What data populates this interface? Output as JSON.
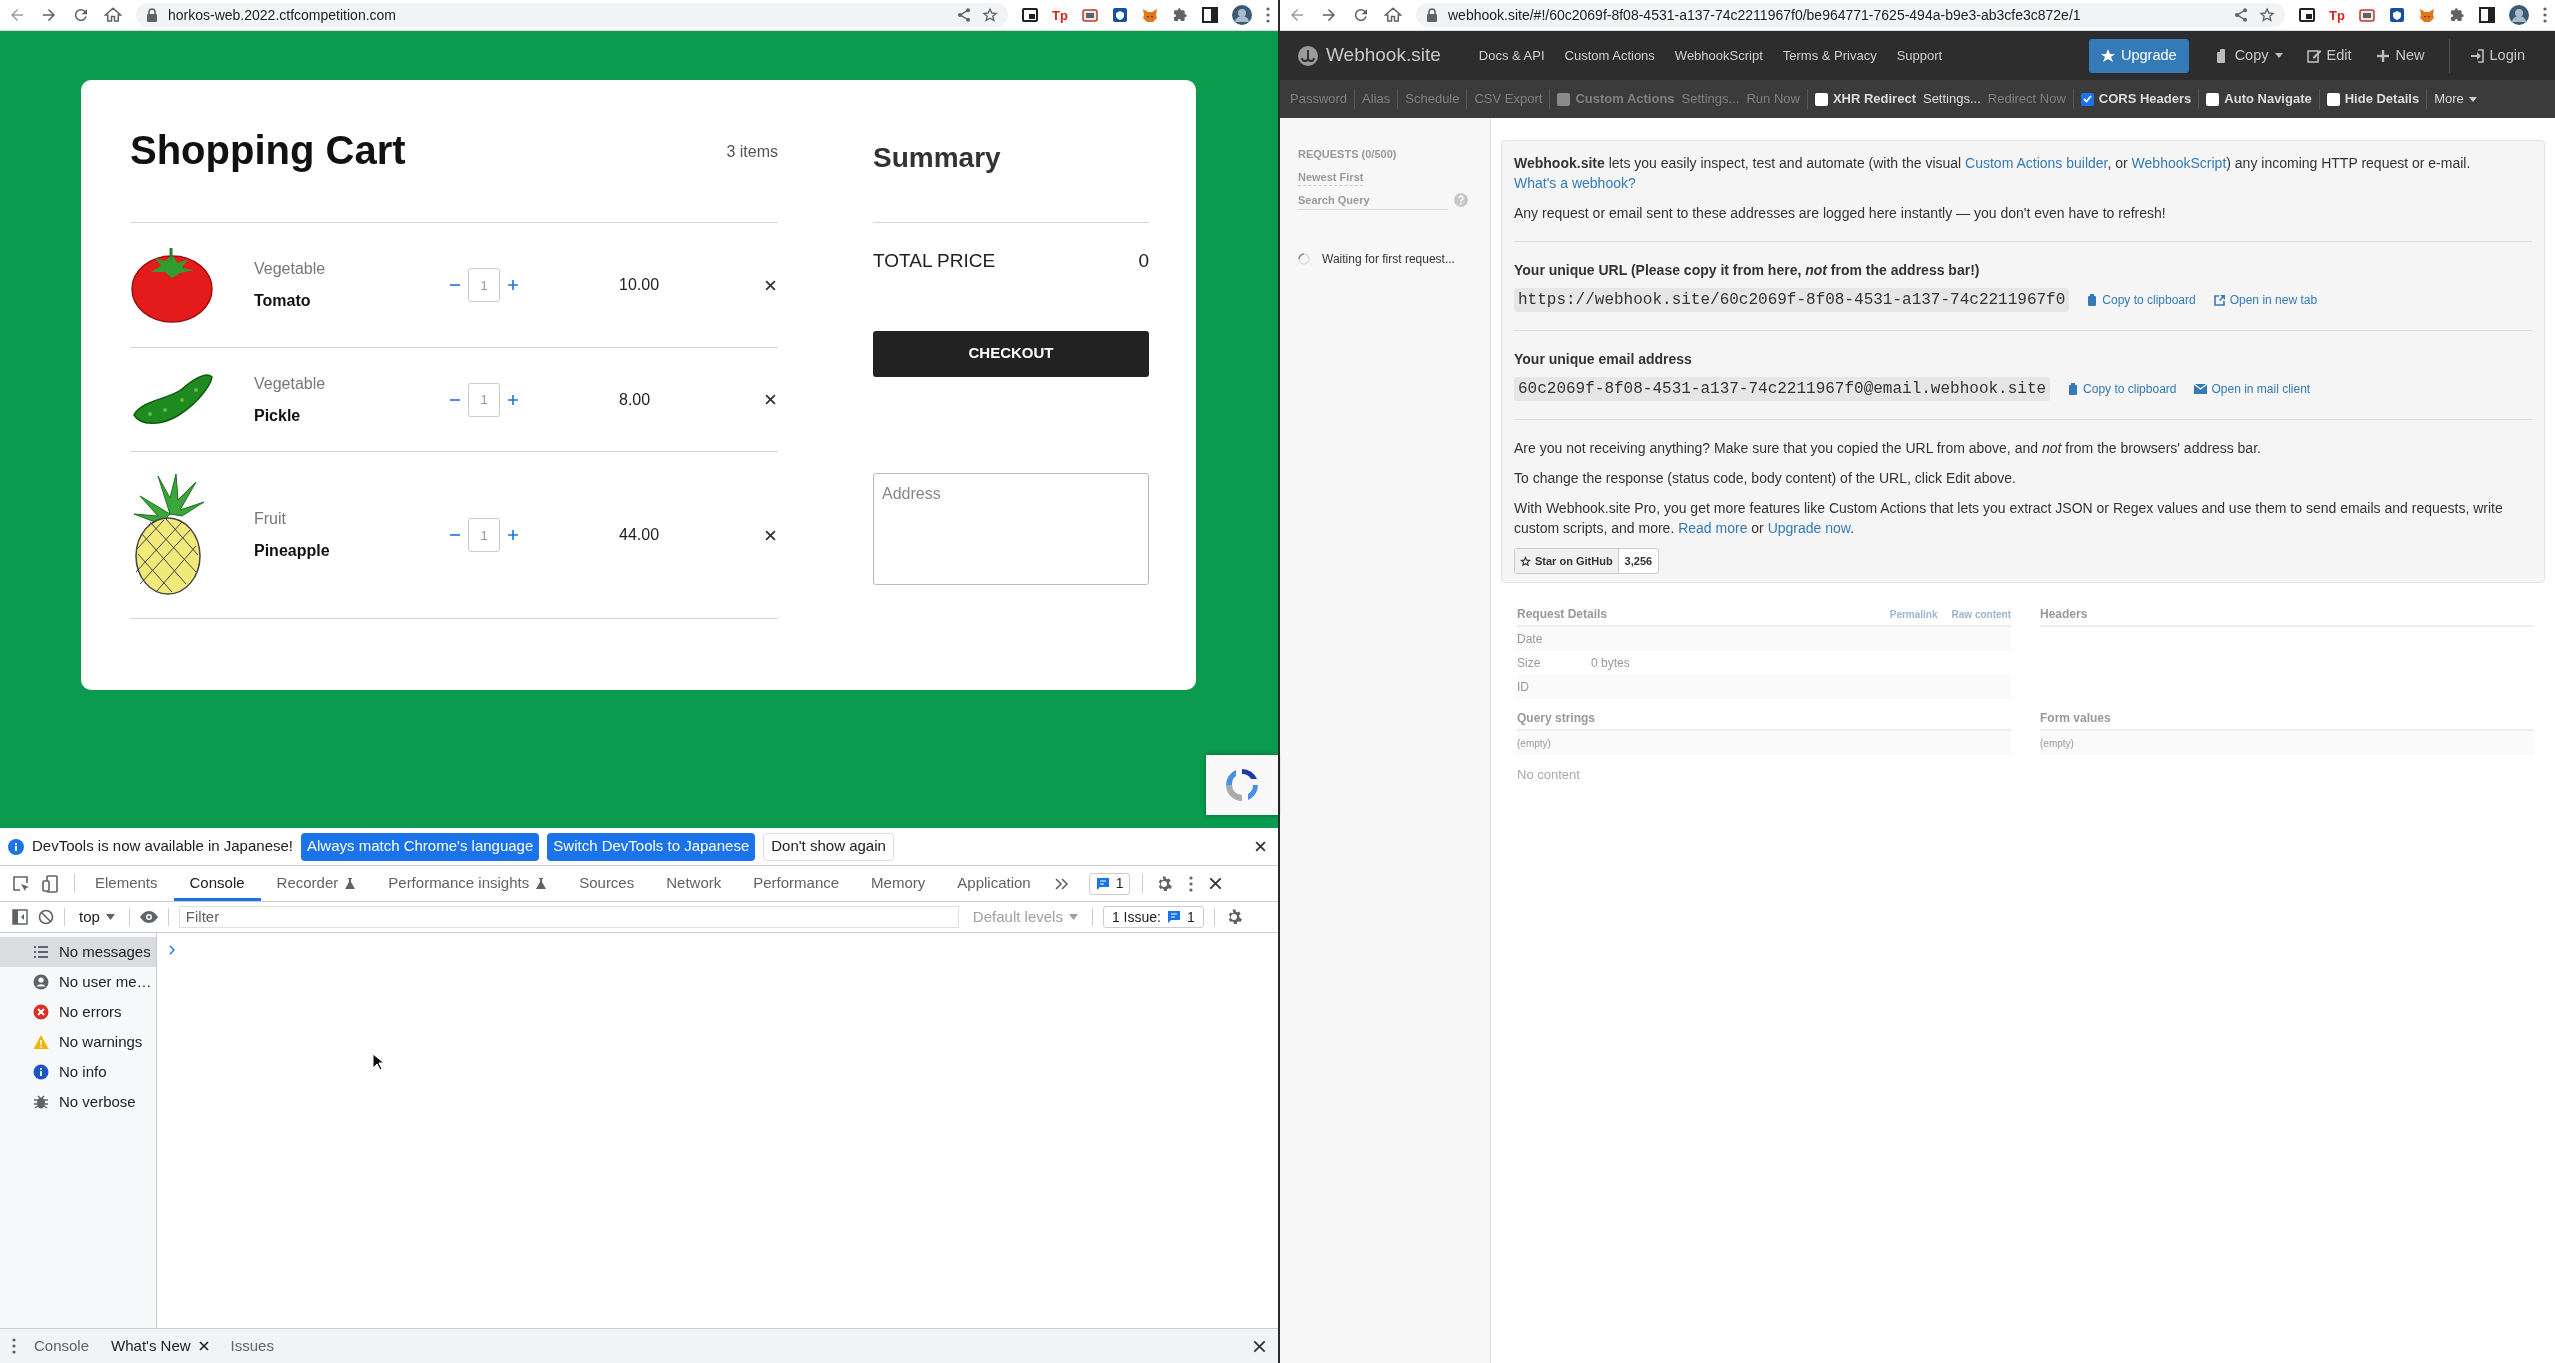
{
  "left_browser": {
    "url": "horkos-web.2022.ctfcompetition.com",
    "extension_label": "Tp"
  },
  "cart": {
    "title": "Shopping Cart",
    "count": "3 items",
    "items": [
      {
        "kind": "tomato",
        "category": "Vegetable",
        "name": "Tomato",
        "quantity": "1",
        "price": "10.00"
      },
      {
        "kind": "pickle",
        "category": "Vegetable",
        "name": "Pickle",
        "quantity": "1",
        "price": "8.00"
      },
      {
        "kind": "pineapple",
        "category": "Fruit",
        "name": "Pineapple",
        "quantity": "1",
        "price": "44.00"
      }
    ],
    "summary": {
      "title": "Summary",
      "total_label": "TOTAL PRICE",
      "total_value": "0",
      "checkout": "CHECKOUT",
      "address_placeholder": "Address"
    }
  },
  "devtools": {
    "banner": {
      "text": "DevTools is now available in Japanese!",
      "buttons": [
        {
          "label": "Always match Chrome's language",
          "primary": true
        },
        {
          "label": "Switch DevTools to Japanese",
          "primary": true
        },
        {
          "label": "Don't show again",
          "primary": false
        }
      ]
    },
    "tabs": [
      {
        "label": "Elements",
        "selected": false,
        "experimental": false
      },
      {
        "label": "Console",
        "selected": true,
        "experimental": false
      },
      {
        "label": "Recorder",
        "selected": false,
        "experimental": true
      },
      {
        "label": "Performance insights",
        "selected": false,
        "experimental": true
      },
      {
        "label": "Sources",
        "selected": false,
        "experimental": false
      },
      {
        "label": "Network",
        "selected": false,
        "experimental": false
      },
      {
        "label": "Performance",
        "selected": false,
        "experimental": false
      },
      {
        "label": "Memory",
        "selected": false,
        "experimental": false
      },
      {
        "label": "Application",
        "selected": false,
        "experimental": false
      }
    ],
    "messages_count": "1",
    "context": "top",
    "filter_placeholder": "Filter",
    "levels": "Default levels",
    "issues_label": "1 Issue:",
    "issues_count": "1",
    "sidebar": [
      {
        "kind": "messages",
        "label": "No messages",
        "selected": true
      },
      {
        "kind": "user",
        "label": "No user me…",
        "selected": false
      },
      {
        "kind": "errors",
        "label": "No errors",
        "selected": false
      },
      {
        "kind": "warnings",
        "label": "No warnings",
        "selected": false
      },
      {
        "kind": "info",
        "label": "No info",
        "selected": false
      },
      {
        "kind": "verbose",
        "label": "No verbose",
        "selected": false
      }
    ],
    "drawer_tabs": [
      {
        "label": "Console",
        "selected": false,
        "closable": false
      },
      {
        "label": "What's New",
        "selected": true,
        "closable": true
      },
      {
        "label": "Issues",
        "selected": false,
        "closable": false
      }
    ]
  },
  "right_browser": {
    "url": "webhook.site/#!/60c2069f-8f08-4531-a137-74c2211967f0/be964771-7625-494a-b9e3-ab3cfe3c872e/1",
    "extension_label": "Tp"
  },
  "webhook": {
    "brand": "Webhook.site",
    "nav": [
      "Docs & API",
      "Custom Actions",
      "WebhookScript",
      "Terms & Privacy",
      "Support"
    ],
    "actions": [
      {
        "kind": "upgrade",
        "label": "Upgrade"
      },
      {
        "kind": "copy",
        "label": "Copy"
      },
      {
        "kind": "edit",
        "label": "Edit"
      },
      {
        "kind": "new",
        "label": "New"
      },
      {
        "kind": "login",
        "label": "Login"
      }
    ],
    "toolbar": [
      {
        "items": [
          {
            "kind": "link",
            "label": "Password",
            "disabled": true
          }
        ]
      },
      {
        "items": [
          {
            "kind": "link",
            "label": "Alias",
            "disabled": true
          }
        ]
      },
      {
        "items": [
          {
            "kind": "link",
            "label": "Schedule",
            "disabled": true
          }
        ]
      },
      {
        "items": [
          {
            "kind": "link",
            "label": "CSV Export",
            "disabled": true
          }
        ]
      },
      {
        "items": [
          {
            "kind": "checkbox",
            "label": "Custom Actions",
            "checked": false,
            "disabled": true
          },
          {
            "kind": "link",
            "label": "Settings...",
            "disabled": true
          },
          {
            "kind": "link",
            "label": "Run Now",
            "disabled": true
          }
        ]
      },
      {
        "items": [
          {
            "kind": "checkbox",
            "label": "XHR Redirect",
            "checked": false,
            "disabled": false
          },
          {
            "kind": "link",
            "label": "Settings...",
            "disabled": false
          },
          {
            "kind": "link",
            "label": "Redirect Now",
            "disabled": true
          }
        ]
      },
      {
        "items": [
          {
            "kind": "checkbox",
            "label": "CORS Headers",
            "checked": true,
            "disabled": false
          }
        ]
      },
      {
        "items": [
          {
            "kind": "checkbox",
            "label": "Auto Navigate",
            "checked": false,
            "disabled": false
          }
        ]
      },
      {
        "items": [
          {
            "kind": "checkbox",
            "label": "Hide Details",
            "checked": false,
            "disabled": false
          }
        ]
      },
      {
        "items": [
          {
            "kind": "dropdown",
            "label": "More",
            "disabled": false
          }
        ]
      }
    ],
    "sidebar": {
      "title": "REQUESTS (0/500)",
      "sort": "Newest First",
      "search_placeholder": "Search Query",
      "status": "Waiting for first request..."
    },
    "intro": [
      [
        {
          "kind": "bold",
          "text": "Webhook.site"
        },
        {
          "kind": "text",
          "text": " lets you easily inspect, test and automate (with the visual "
        },
        {
          "kind": "link",
          "text": "Custom Actions builder"
        },
        {
          "kind": "text",
          "text": ", or "
        },
        {
          "kind": "link",
          "text": "WebhookScript"
        },
        {
          "kind": "text",
          "text": ") any incoming HTTP request or e-mail. "
        },
        {
          "kind": "link",
          "text": "What's a webhook?"
        }
      ],
      [
        {
          "kind": "text",
          "text": "Any request or email sent to these addresses are logged here instantly — you don't even have to refresh!"
        }
      ]
    ],
    "url_section": {
      "heading": "Your unique URL (Please copy it from here, *not* from the address bar!)",
      "value": "https://webhook.site/60c2069f-8f08-4531-a137-74c2211967f0",
      "actions": [
        {
          "kind": "copy",
          "label": "Copy to clipboard"
        },
        {
          "kind": "external",
          "label": "Open in new tab"
        }
      ]
    },
    "email_section": {
      "heading": "Your unique email address",
      "value": "60c2069f-8f08-4531-a137-74c2211967f0@email.webhook.site",
      "actions": [
        {
          "kind": "copy",
          "label": "Copy to clipboard"
        },
        {
          "kind": "mail",
          "label": "Open in mail client"
        }
      ]
    },
    "notes": [
      [
        {
          "kind": "text",
          "text": "Are you not receiving anything? Make sure that you copied the URL from above, and "
        },
        {
          "kind": "italic",
          "text": "not"
        },
        {
          "kind": "text",
          "text": " from the browsers' address bar."
        }
      ],
      [
        {
          "kind": "text",
          "text": "To change the response (status code, body content) of the URL, click Edit above."
        }
      ],
      [
        {
          "kind": "text",
          "text": "With Webhook.site Pro, you get more features like Custom Actions that lets you extract JSON or Regex values and use them to send emails and requests, write custom scripts, and more. "
        },
        {
          "kind": "link",
          "text": "Read more"
        },
        {
          "kind": "text",
          "text": " or "
        },
        {
          "kind": "link",
          "text": "Upgrade now"
        },
        {
          "kind": "text",
          "text": "."
        }
      ]
    ],
    "github": {
      "label": "Star on GitHub",
      "count": "3,256"
    },
    "details": {
      "title": "Request Details",
      "links": [
        "Permalink",
        "Raw content"
      ],
      "rows": [
        {
          "label": "Date"
        },
        {
          "label": "Size",
          "value": "0 bytes"
        },
        {
          "label": "ID"
        }
      ],
      "headers_title": "Headers",
      "query": {
        "title": "Query strings",
        "value": "(empty)"
      },
      "form": {
        "title": "Form values",
        "value": "(empty)"
      },
      "body": "No content"
    }
  }
}
